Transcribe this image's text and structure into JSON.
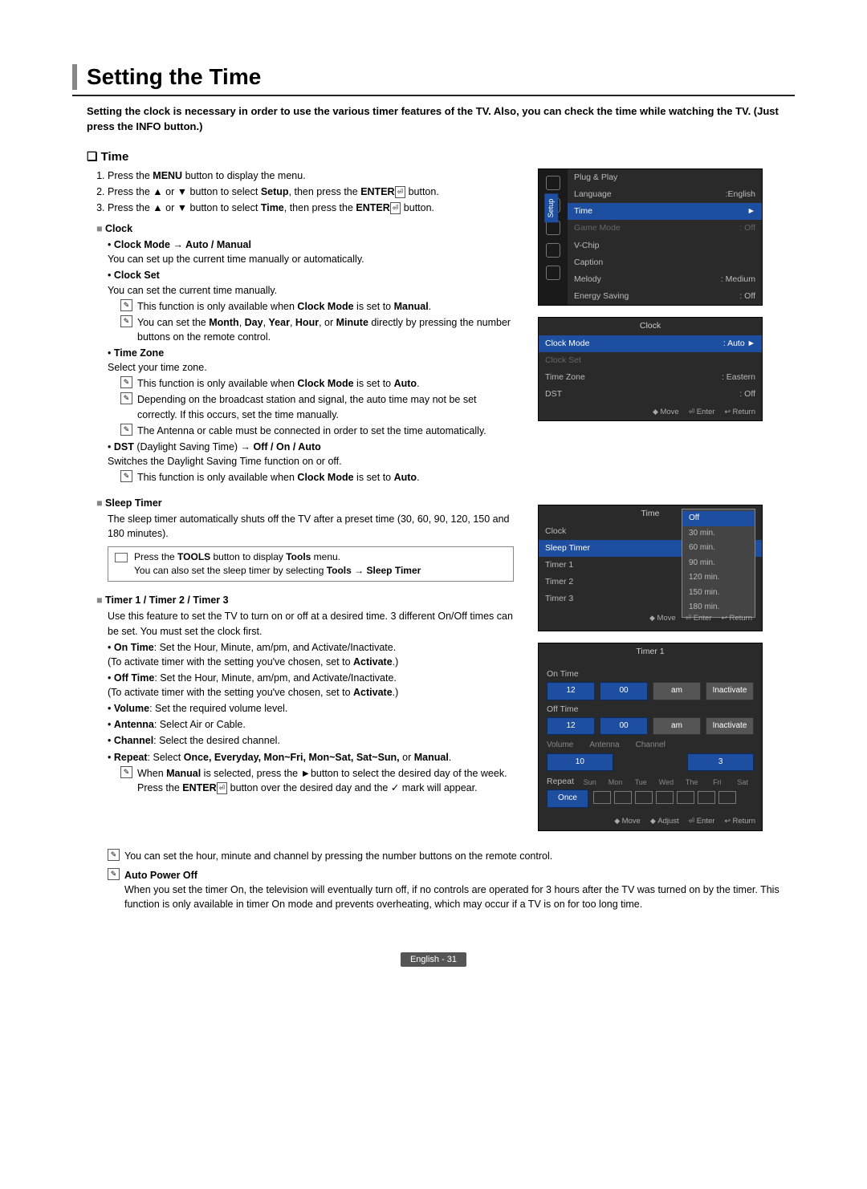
{
  "title": "Setting the Time",
  "intro": "Setting the clock is necessary in order to use the various timer features of the TV. Also, you can check the time while watching the TV. (Just press the INFO button.)",
  "section_time": "Time",
  "steps": {
    "s1a": "Press the ",
    "s1b": "MENU",
    "s1c": " button to display the menu.",
    "s2a": "Press the ▲ or ▼ button to select ",
    "s2b": "Setup",
    "s2c": ", then press the ",
    "s2d": "ENTER",
    "s2e": " button.",
    "s3a": "Press the ▲ or ▼ button to select ",
    "s3b": "Time",
    "s3c": ", then press the ",
    "s3d": "ENTER",
    "s3e": " button."
  },
  "clock": {
    "h": "Clock",
    "mode_h": "Clock Mode → Auto / Manual",
    "mode_t": "You can set up the current time manually or automatically.",
    "set_h": "Clock Set",
    "set_t": "You can set the current time manually.",
    "set_n1a": "This function is only available when ",
    "set_n1b": "Clock Mode",
    "set_n1c": " is set to ",
    "set_n1d": "Manual",
    "set_n1e": ".",
    "set_n2a": "You can set the ",
    "set_n2b": "Month",
    "set_n2c": ", ",
    "set_n2d": "Day",
    "set_n2e": ", ",
    "set_n2f": "Year",
    "set_n2g": ", ",
    "set_n2h": "Hour",
    "set_n2i": ", or ",
    "set_n2j": "Minute",
    "set_n2k": " directly by pressing the number buttons on the remote control.",
    "tz_h": "Time Zone",
    "tz_t": "Select your time zone.",
    "tz_n1a": "This function is only available when ",
    "tz_n1b": "Clock Mode",
    "tz_n1c": " is set to ",
    "tz_n1d": "Auto",
    "tz_n1e": ".",
    "tz_n2": "Depending on the broadcast station and signal, the auto time may not be set correctly. If this occurs, set the time manually.",
    "tz_n3": "The Antenna or cable must be connected in order to set the time automatically.",
    "dst_h1": "DST",
    "dst_h2": " (Daylight Saving Time) ",
    "dst_h3": "→ Off / On / Auto",
    "dst_t": "Switches the Daylight Saving Time function on or off.",
    "dst_n1a": "This function is only available when ",
    "dst_n1b": "Clock Mode",
    "dst_n1c": " is set to ",
    "dst_n1d": "Auto",
    "dst_n1e": "."
  },
  "sleep": {
    "h": "Sleep Timer",
    "t": "The sleep timer automatically shuts off the TV after a preset time (30, 60, 90, 120, 150 and 180 minutes).",
    "tip1a": "Press the ",
    "tip1b": "TOOLS",
    "tip1c": " button to display ",
    "tip1d": "Tools",
    "tip1e": " menu.",
    "tip2a": "You can also set the sleep timer by selecting ",
    "tip2b": "Tools → Sleep Timer"
  },
  "timers": {
    "h": "Timer 1 / Timer 2 / Timer 3",
    "t": "Use this feature to set the TV to turn on or off at a desired time. 3 different On/Off times can be set. You must set the clock first.",
    "on_h": "On Time",
    "on_t": ": Set the Hour, Minute, am/pm, and Activate/Inactivate.",
    "on_p": "(To activate timer with the setting you've chosen, set to ",
    "on_pb": "Activate",
    "on_pe": ".)",
    "off_h": "Off Time",
    "off_t": ": Set the Hour, Minute, am/pm, and Activate/Inactivate.",
    "vol_h": "Volume",
    "vol_t": ": Set the required volume level.",
    "ant_h": "Antenna",
    "ant_t": ": Select Air or Cable.",
    "ch_h": "Channel",
    "ch_t": ": Select the desired channel.",
    "rep_h": "Repeat",
    "rep_t1": ": Select ",
    "rep_t2": "Once, Everyday, Mon~Fri, Mon~Sat, Sat~Sun,",
    "rep_t3": " or ",
    "rep_t4": "Manual",
    "rep_t5": ".",
    "rep_n1a": "When ",
    "rep_n1b": "Manual",
    "rep_n1c": " is selected, press the ►button to select the desired day of the week. Press the ",
    "rep_n1d": "ENTER",
    "rep_n1e": " button over the desired day and the ✓ mark will appear.",
    "num_note": "You can set the hour, minute and channel by pressing the number buttons on the remote control.",
    "apo_h": "Auto Power Off",
    "apo_t": "When you set the timer On, the television will eventually turn off, if no controls are operated for 3 hours after the TV was turned on by the timer. This function is only available in timer On mode and prevents overheating, which may occur if a TV is on for too long time."
  },
  "osd_setup": {
    "side": "Setup",
    "rows": [
      {
        "l": "Plug & Play",
        "v": ""
      },
      {
        "l": "Language",
        "v": ":English"
      },
      {
        "l": "Time",
        "v": "",
        "sel": true
      },
      {
        "l": "Game Mode",
        "v": ": Off",
        "dim": true
      },
      {
        "l": "V-Chip",
        "v": ""
      },
      {
        "l": "Caption",
        "v": ""
      },
      {
        "l": "Melody",
        "v": ": Medium"
      },
      {
        "l": "Energy Saving",
        "v": ": Off"
      }
    ]
  },
  "osd_clock": {
    "title": "Clock",
    "rows": [
      {
        "l": "Clock Mode",
        "v": ": Auto",
        "sel": true
      },
      {
        "l": "Clock Set",
        "v": "",
        "dim": true
      },
      {
        "l": "Time Zone",
        "v": ": Eastern"
      },
      {
        "l": "DST",
        "v": ": Off"
      }
    ],
    "foot": [
      "Move",
      "Enter",
      "Return"
    ]
  },
  "osd_time": {
    "title": "Time",
    "rows": [
      {
        "l": "Clock",
        "v": ""
      },
      {
        "l": "Sleep Timer",
        "v": "",
        "sel": true
      },
      {
        "l": "Timer 1",
        "v": ""
      },
      {
        "l": "Timer 2",
        "v": ""
      },
      {
        "l": "Timer 3",
        "v": ""
      }
    ],
    "opts": [
      "Off",
      "30 min.",
      "60 min.",
      "90 min.",
      "120 min.",
      "150 min.",
      "180 min."
    ],
    "foot": [
      "Move",
      "Enter",
      "Return"
    ]
  },
  "osd_timer1": {
    "title": "Timer 1",
    "on": "On Time",
    "off": "Off Time",
    "cells_on": [
      "12",
      "00",
      "am",
      "Inactivate"
    ],
    "cells_off": [
      "12",
      "00",
      "am",
      "Inactivate"
    ],
    "vol_l": "Volume",
    "ant_l": "Antenna",
    "ch_l": "Channel",
    "vol_v": "10",
    "ch_v": "3",
    "rep": "Repeat",
    "days": [
      "Sun",
      "Mon",
      "Tue",
      "Wed",
      "The",
      "Fri",
      "Sat"
    ],
    "once": "Once",
    "foot": [
      "Move",
      "Adjust",
      "Enter",
      "Return"
    ]
  },
  "footer": "English - 31"
}
